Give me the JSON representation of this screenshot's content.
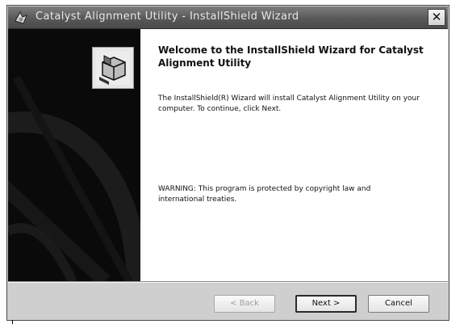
{
  "window": {
    "title": "Catalyst Alignment Utility - InstallShield Wizard",
    "close_glyph": "✕"
  },
  "content": {
    "heading": "Welcome to the InstallShield Wizard for Catalyst Alignment Utility",
    "intro": "The InstallShield(R) Wizard will install Catalyst Alignment Utility on your computer. To continue, click Next.",
    "warning": "WARNING: This program is protected by copyright law and international treaties."
  },
  "buttons": {
    "back_label": "< Back",
    "next_label": "Next >",
    "cancel_label": "Cancel"
  },
  "colors": {
    "sidebar": "#0a0a0a",
    "titlebar": "#585858",
    "dialog": "#cfcfcf"
  },
  "icons": {
    "app": "installer-icon",
    "product": "product-box-icon",
    "close": "close-icon"
  }
}
